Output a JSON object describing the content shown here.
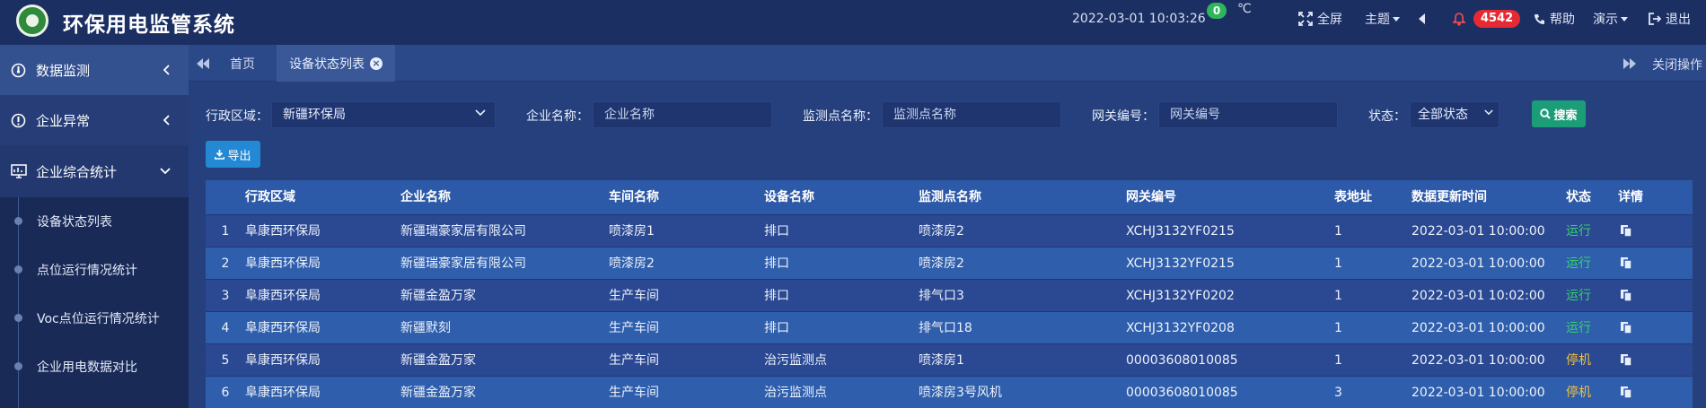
{
  "header": {
    "title": "环保用电监管系统",
    "datetime": "2022-03-01  10:03:26",
    "temp_value": "0",
    "temp_unit": "℃",
    "fullscreen": "全屏",
    "theme": "主题",
    "alarm_count": "4542",
    "help": "帮助",
    "demo": "演示",
    "logout": "退出",
    "icons": [
      "logo",
      "expand-icon",
      "caret-left-icon",
      "bell-icon",
      "phone-icon",
      "logout-icon"
    ]
  },
  "sidebar": {
    "items": [
      {
        "label": "数据监测",
        "icon": "gauge-icon"
      },
      {
        "label": "企业异常",
        "icon": "alert-circle-icon"
      },
      {
        "label": "企业综合统计",
        "icon": "monitor-chart-icon"
      }
    ],
    "subitems": [
      "设备状态列表",
      "点位运行情况统计",
      "Voc点位运行情况统计",
      "企业用电数据对比"
    ]
  },
  "tabs": {
    "home": "首页",
    "active": "设备状态列表",
    "close_ops": "关闭操作"
  },
  "filters": {
    "region_label": "行政区域：",
    "region_value": "新疆环保局",
    "enterprise_label": "企业名称：",
    "enterprise_placeholder": "企业名称",
    "monitor_label": "监测点名称：",
    "monitor_placeholder": "监测点名称",
    "gateway_label": "网关编号：",
    "gateway_placeholder": "网关编号",
    "status_label": "状态：",
    "status_value": "全部状态",
    "search_button": "搜索",
    "export_button": "导出"
  },
  "table": {
    "headers": [
      "",
      "行政区域",
      "企业名称",
      "车间名称",
      "设备名称",
      "监测点名称",
      "网关编号",
      "表地址",
      "数据更新时间",
      "状态",
      "详情"
    ],
    "rows": [
      [
        "1",
        "阜康西环保局",
        "新疆瑞豪家居有限公司",
        "喷漆房1",
        "排口",
        "喷漆房2",
        "XCHJ3132YF0215",
        "1",
        "2022-03-01 10:00:00",
        "运行"
      ],
      [
        "2",
        "阜康西环保局",
        "新疆瑞豪家居有限公司",
        "喷漆房2",
        "排口",
        "喷漆房2",
        "XCHJ3132YF0215",
        "1",
        "2022-03-01 10:00:00",
        "运行"
      ],
      [
        "3",
        "阜康西环保局",
        "新疆金盈万家",
        "生产车间",
        "排口",
        "排气口3",
        "XCHJ3132YF0202",
        "1",
        "2022-03-01 10:02:00",
        "运行"
      ],
      [
        "4",
        "阜康西环保局",
        "新疆默刻",
        "生产车间",
        "排口",
        "排气口18",
        "XCHJ3132YF0208",
        "1",
        "2022-03-01 10:00:00",
        "运行"
      ],
      [
        "5",
        "阜康西环保局",
        "新疆金盈万家",
        "生产车间",
        "治污监测点",
        "喷漆房1",
        "00003608010085",
        "1",
        "2022-03-01 10:00:00",
        "停机"
      ],
      [
        "6",
        "阜康西环保局",
        "新疆金盈万家",
        "生产车间",
        "治污监测点",
        "喷漆房3号风机",
        "00003608010085",
        "3",
        "2022-03-01 10:00:00",
        "停机"
      ]
    ]
  },
  "colors": {
    "running": "#36d16a",
    "stopped": "#f2c03a",
    "alarm": "#e52a33",
    "search": "#1b9e78",
    "export": "#2489d4"
  }
}
